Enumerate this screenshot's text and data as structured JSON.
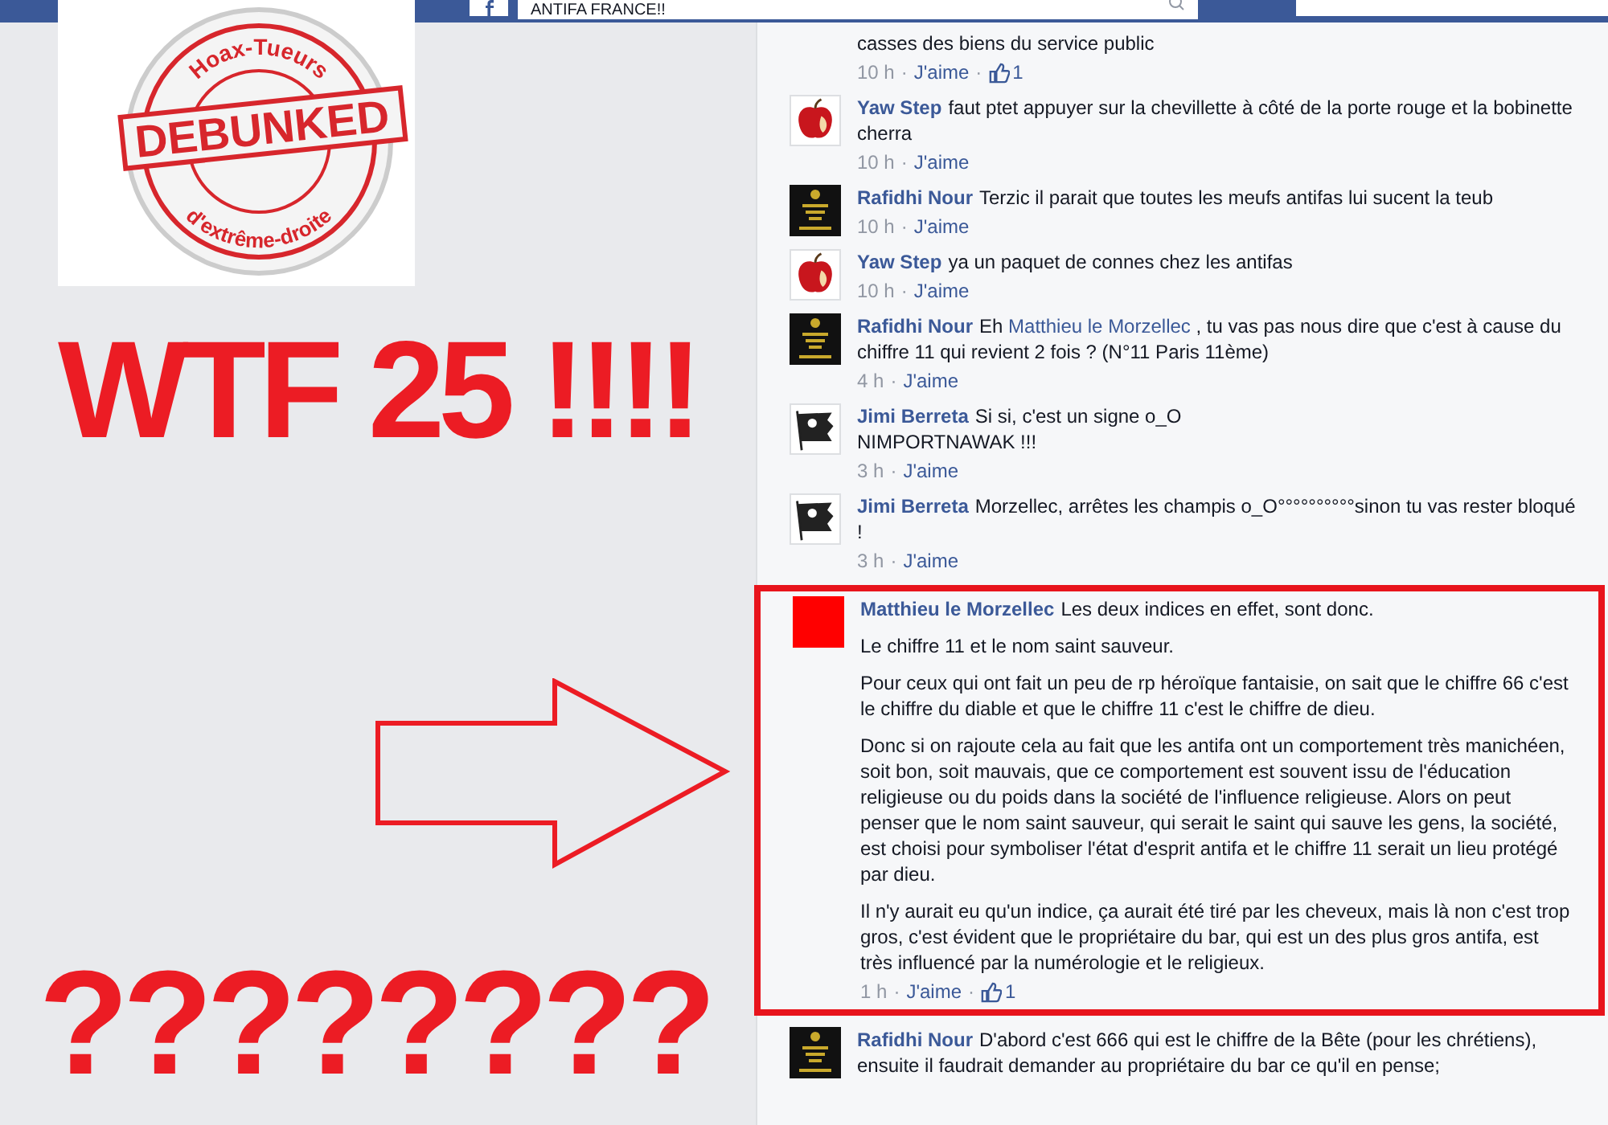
{
  "header": {
    "search_value": "ANTIFA FRANCE!!"
  },
  "sticker": {
    "top_text": "Hoax-Tueurs",
    "band_text": "DEBUNKED",
    "bottom_text": "d'extrême-droite"
  },
  "headline": "WTF 25 !!!!",
  "question_marks": "????????",
  "separator": "·",
  "comments": [
    {
      "highlighted": false,
      "paragraphs": [
        [
          {
            "kind": "plain",
            "text": "casses des biens du service public"
          }
        ]
      ],
      "time": "10 h",
      "like_label": "J'aime",
      "likes": "1"
    },
    {
      "avatar": {
        "kind": "apple"
      },
      "highlighted": false,
      "author": "Yaw Step",
      "paragraphs": [
        [
          {
            "kind": "plain",
            "text": "faut ptet appuyer sur la chevillette à côté de la porte rouge et la bobinette cherra"
          }
        ]
      ],
      "time": "10 h",
      "like_label": "J'aime"
    },
    {
      "avatar": {
        "kind": "keep-calm"
      },
      "highlighted": false,
      "author": "Rafidhi Nour",
      "paragraphs": [
        [
          {
            "kind": "plain",
            "text": "Terzic il parait que toutes les meufs antifas lui sucent la teub"
          }
        ]
      ],
      "time": "10 h",
      "like_label": "J'aime"
    },
    {
      "avatar": {
        "kind": "apple"
      },
      "highlighted": false,
      "author": "Yaw Step",
      "paragraphs": [
        [
          {
            "kind": "plain",
            "text": "ya un paquet de connes chez les antifas"
          }
        ]
      ],
      "time": "10 h",
      "like_label": "J'aime"
    },
    {
      "avatar": {
        "kind": "keep-calm"
      },
      "highlighted": false,
      "author": "Rafidhi Nour",
      "paragraphs": [
        [
          {
            "kind": "plain",
            "text": "Eh"
          },
          {
            "kind": "mention",
            "text": "Matthieu le Morzellec"
          },
          {
            "kind": "plain",
            "text": ", tu vas pas nous dire que c'est à cause du chiffre 11 qui revient 2 fois ? (N°11 Paris 11ème)"
          }
        ]
      ],
      "time": "4 h",
      "like_label": "J'aime"
    },
    {
      "avatar": {
        "kind": "flag"
      },
      "highlighted": false,
      "author": "Jimi Berreta",
      "paragraphs": [
        [
          {
            "kind": "plain",
            "text": "Si si, c'est un signe o_O"
          }
        ],
        [
          {
            "kind": "plain",
            "text": "NIMPORTNAWAK !!!"
          }
        ]
      ],
      "time": "3 h",
      "like_label": "J'aime"
    },
    {
      "avatar": {
        "kind": "flag"
      },
      "highlighted": false,
      "author": "Jimi Berreta",
      "paragraphs": [
        [
          {
            "kind": "plain",
            "text": "Morzellec, arrêtes les champis o_O°°°°°°°°°°sinon tu vas rester bloqué !"
          }
        ]
      ],
      "time": "3 h",
      "like_label": "J'aime"
    },
    {
      "avatar": {
        "kind": "red"
      },
      "highlighted": true,
      "author": "Matthieu le Morzellec",
      "paragraphs": [
        [
          {
            "kind": "plain",
            "text": "Les deux indices en effet, sont donc."
          }
        ],
        [
          {
            "kind": "plain",
            "text": "Le chiffre 11 et le nom saint sauveur."
          }
        ],
        [
          {
            "kind": "plain",
            "text": "Pour ceux qui ont fait un peu de rp héroïque fantaisie, on sait que le chiffre 66 c'est le chiffre du diable et que le chiffre 11 c'est le chiffre de dieu."
          }
        ],
        [
          {
            "kind": "plain",
            "text": "Donc si on rajoute cela au fait que les antifa ont un comportement très manichéen, soit bon, soit mauvais, que ce comportement est souvent issu de l'éducation religieuse ou du poids dans la société de l'influence religieuse. Alors on peut penser que le nom saint sauveur, qui serait le saint qui sauve les gens, la société, est choisi pour symboliser l'état d'esprit antifa et le chiffre 11 serait un lieu protégé par dieu."
          }
        ],
        [
          {
            "kind": "plain",
            "text": "Il n'y aurait eu qu'un indice, ça aurait été tiré par les cheveux, mais là non c'est trop gros, c'est évident que le propriétaire du bar, qui est un des plus gros antifa, est très influencé par la numérologie et le religieux."
          }
        ]
      ],
      "time": "1 h",
      "like_label": "J'aime",
      "likes": "1"
    },
    {
      "avatar": {
        "kind": "keep-calm"
      },
      "highlighted": false,
      "author": "Rafidhi Nour",
      "paragraphs": [
        [
          {
            "kind": "plain",
            "text": "D'abord c'est 666 qui est le chiffre de la Bête (pour les chrétiens), ensuite il faudrait demander au propriétaire du bar ce qu'il en pense;"
          }
        ]
      ]
    }
  ]
}
